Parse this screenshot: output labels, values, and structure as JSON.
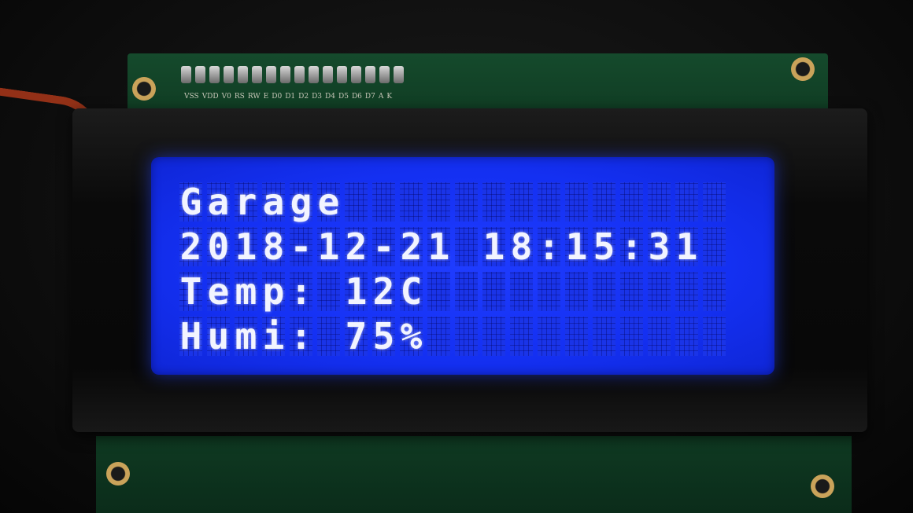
{
  "pin_labels": [
    "VSS",
    "VDD",
    "V0",
    "RS",
    "RW",
    "E",
    "D0",
    "D1",
    "D2",
    "D3",
    "D4",
    "D5",
    "D6",
    "D7",
    "A",
    "K"
  ],
  "lcd": {
    "columns": 20,
    "rows": [
      "Garage",
      "2018-12-21 18:15:31",
      "Temp: 12C",
      "Humi: 75%"
    ]
  },
  "colors": {
    "backlight": "#1a34e8",
    "text": "#f2f4ff",
    "pcb": "#154a2c"
  }
}
